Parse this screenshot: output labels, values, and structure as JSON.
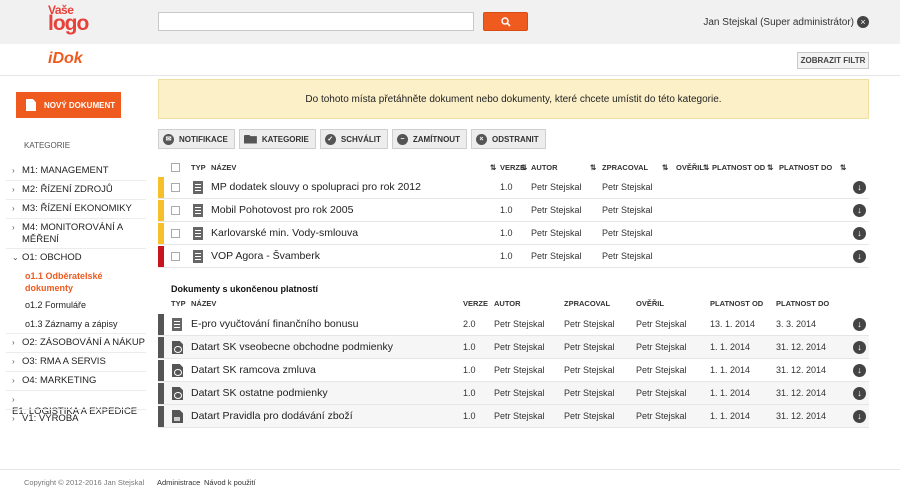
{
  "header": {
    "logo_line1": "Vaše",
    "logo_line2": "logo",
    "search_placeholder": "",
    "user": "Jan Stejskal (Super administrátor)",
    "app_title": "iDok",
    "filter_button": "ZOBRAZIT FILTR"
  },
  "sidebar": {
    "new_document": "NOVÝ DOKUMENT",
    "category_label": "KATEGORIE",
    "items": [
      {
        "label": "M1: MANAGEMENT"
      },
      {
        "label": "M2: ŘÍZENÍ ZDROJŮ"
      },
      {
        "label": "M3: ŘÍZENÍ EKONOMIKY"
      },
      {
        "label": "M4: MONITOROVÁNÍ A MĚŘENÍ"
      },
      {
        "label": "O1: OBCHOD",
        "expanded": true
      },
      {
        "label": "O2: ZÁSOBOVÁNÍ A NÁKUP"
      },
      {
        "label": "O3: RMA A SERVIS"
      },
      {
        "label": "O4: MARKETING"
      },
      {
        "label": "E1: LOGISTIKA A EXPEDICE"
      },
      {
        "label": "V1: VÝROBA"
      }
    ],
    "subitems": [
      {
        "label": "o1.1 Odběratelské dokumenty",
        "active": true
      },
      {
        "label": "o1.2 Formuláře"
      },
      {
        "label": "o1.3 Záznamy a zápisy"
      }
    ]
  },
  "dropzone_text": "Do tohoto místa přetáhněte dokument nebo dokumenty, které chcete umístit do této kategorie.",
  "toolbar": {
    "notifikace": "NOTIFIKACE",
    "kategorie": "KATEGORIE",
    "schvalit": "SCHVÁLIT",
    "zamitnout": "ZAMÍTNOUT",
    "odstranit": "ODSTRANIT"
  },
  "table1": {
    "headers": {
      "typ": "TYP",
      "nazev": "NÁZEV",
      "verze": "VERZE",
      "autor": "AUTOR",
      "zpracoval": "ZPRACOVAL",
      "overil": "OVĚŘIL",
      "platnost_od": "PLATNOST OD",
      "platnost_do": "PLATNOST DO"
    },
    "rows": [
      {
        "name": "MP dodatek slouvy o spolupraci pro rok 2012",
        "version": "1.0",
        "author": "Petr Stejskal",
        "processed": "Petr Stejskal",
        "status_color": "#f5c02a"
      },
      {
        "name": "Mobil Pohotovost pro rok 2005",
        "version": "1.0",
        "author": "Petr Stejskal",
        "processed": "Petr Stejskal",
        "status_color": "#f5c02a"
      },
      {
        "name": "Karlovarské min. Vody-smlouva",
        "version": "1.0",
        "author": "Petr Stejskal",
        "processed": "Petr Stejskal",
        "status_color": "#f5c02a"
      },
      {
        "name": "VOP Agora - Švamberk",
        "version": "1.0",
        "author": "Petr Stejskal",
        "processed": "Petr Stejskal",
        "status_color": "#c8141e"
      }
    ]
  },
  "table2": {
    "title": "Dokumenty s ukončenou platností",
    "headers": {
      "typ": "TYP",
      "nazev": "NÁZEV",
      "verze": "VERZE",
      "autor": "AUTOR",
      "zpracoval": "ZPRACOVAL",
      "overil": "OVĚŘIL",
      "platnost_od": "PLATNOST OD",
      "platnost_do": "PLATNOST DO"
    },
    "rows": [
      {
        "icon": "doc-icon",
        "name": "E-pro vyučtování finančního bonusu",
        "version": "2.0",
        "author": "Petr Stejskal",
        "processed": "Petr Stejskal",
        "verified": "Petr Stejskal",
        "from": "13. 1. 2014",
        "to": "3. 3. 2014"
      },
      {
        "icon": "pdf-icon",
        "name": "Datart SK vseobecne obchodne podmienky",
        "version": "1.0",
        "author": "Petr Stejskal",
        "processed": "Petr Stejskal",
        "verified": "Petr Stejskal",
        "from": "1. 1. 2014",
        "to": "31. 12. 2014"
      },
      {
        "icon": "pdf-icon",
        "name": "Datart SK ramcova zmluva",
        "version": "1.0",
        "author": "Petr Stejskal",
        "processed": "Petr Stejskal",
        "verified": "Petr Stejskal",
        "from": "1. 1. 2014",
        "to": "31. 12. 2014"
      },
      {
        "icon": "pdf-icon",
        "name": "Datart SK ostatne podmienky",
        "version": "1.0",
        "author": "Petr Stejskal",
        "processed": "Petr Stejskal",
        "verified": "Petr Stejskal",
        "from": "1. 1. 2014",
        "to": "31. 12. 2014"
      },
      {
        "icon": "image-icon",
        "name": "Datart Pravidla pro dodávání zboží",
        "version": "1.0",
        "author": "Petr Stejskal",
        "processed": "Petr Stejskal",
        "verified": "Petr Stejskal",
        "from": "1. 1. 2014",
        "to": "31. 12. 2014"
      }
    ]
  },
  "footer": {
    "copyright": "Copyright © 2012-2016 Jan Stejskal",
    "admin": "Administrace",
    "manual": "Návod k použití"
  },
  "colors": {
    "accent": "#ef5a1f",
    "pending": "#f5c02a",
    "rejected": "#c8141e",
    "expired": "#555555"
  }
}
